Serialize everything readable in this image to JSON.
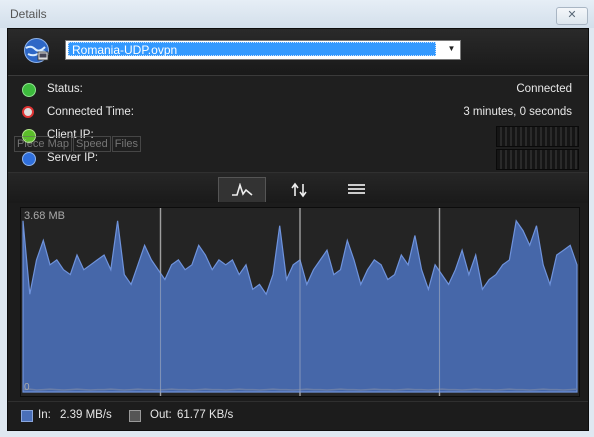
{
  "window": {
    "title": "Details",
    "close_label": "✕"
  },
  "profile": {
    "selected": "Romania-UDP.ovpn"
  },
  "info": {
    "status_label": "Status:",
    "status_value": "Connected",
    "time_label": "Connected Time:",
    "time_value": "3 minutes, 0 seconds",
    "client_ip_label": "Client IP:",
    "server_ip_label": "Server IP:"
  },
  "ghost_tabs": [
    "Piece Map",
    "Speed",
    "Files"
  ],
  "tabs": [
    {
      "name": "graph",
      "icon": "line-graph-icon"
    },
    {
      "name": "transfer",
      "icon": "up-down-arrows-icon"
    },
    {
      "name": "log",
      "icon": "list-icon"
    }
  ],
  "chart_data": {
    "type": "area",
    "ymax_label": "3.68 MB",
    "ymin_label": "0",
    "ylim": [
      0,
      3.68
    ],
    "x": [
      0,
      1,
      2,
      3,
      4,
      5,
      6,
      7,
      8,
      9,
      10,
      11,
      12,
      13,
      14,
      15,
      16,
      17,
      18,
      19,
      20,
      21,
      22,
      23,
      24,
      25,
      26,
      27,
      28,
      29,
      30,
      31,
      32,
      33,
      34,
      35,
      36,
      37,
      38,
      39,
      40,
      41,
      42,
      43,
      44,
      45,
      46,
      47,
      48,
      49,
      50,
      51,
      52,
      53,
      54,
      55,
      56,
      57,
      58,
      59,
      60,
      61,
      62,
      63,
      64,
      65,
      66,
      67,
      68,
      69,
      70,
      71,
      72,
      73,
      74,
      75,
      76,
      77,
      78,
      79,
      80,
      81,
      82
    ],
    "series": [
      {
        "in_values": [
          3.5,
          2.0,
          2.7,
          3.1,
          2.6,
          2.7,
          2.5,
          2.4,
          2.8,
          2.5,
          2.6,
          2.7,
          2.8,
          2.5,
          3.5,
          2.4,
          2.2,
          2.6,
          3.0,
          2.7,
          2.5,
          2.3,
          2.6,
          2.7,
          2.5,
          2.6,
          3.0,
          2.8,
          2.5,
          2.7,
          2.6,
          2.7,
          2.4,
          2.6,
          2.1,
          2.2,
          2.0,
          2.4,
          3.4,
          2.3,
          2.6,
          2.7,
          2.2,
          2.5,
          2.7,
          2.9,
          2.4,
          2.5,
          3.1,
          2.7,
          2.2,
          2.5,
          2.7,
          2.6,
          2.3,
          2.4,
          2.8,
          2.6,
          3.2,
          2.5,
          2.1,
          2.6,
          2.4,
          2.2,
          2.5,
          2.9,
          2.4,
          2.8,
          2.1,
          2.3,
          2.4,
          2.6,
          2.7,
          3.5,
          3.3,
          3.0,
          3.4,
          2.6,
          2.2,
          2.8,
          2.9,
          3.0,
          2.6
        ],
        "out_values": [
          0.05,
          0.06,
          0.04,
          0.05,
          0.06,
          0.05,
          0.04,
          0.05,
          0.06,
          0.05,
          0.04,
          0.05,
          0.05,
          0.06,
          0.05,
          0.04,
          0.05,
          0.06,
          0.05,
          0.05,
          0.04,
          0.05,
          0.06,
          0.05,
          0.05,
          0.04,
          0.05,
          0.06,
          0.05,
          0.05,
          0.04,
          0.05,
          0.06,
          0.05,
          0.05,
          0.04,
          0.05,
          0.06,
          0.05,
          0.05,
          0.04,
          0.05,
          0.06,
          0.05,
          0.05,
          0.04,
          0.05,
          0.06,
          0.05,
          0.05,
          0.04,
          0.05,
          0.06,
          0.05,
          0.05,
          0.04,
          0.05,
          0.06,
          0.05,
          0.05,
          0.04,
          0.05,
          0.06,
          0.05,
          0.05,
          0.04,
          0.05,
          0.06,
          0.05,
          0.05,
          0.04,
          0.05,
          0.06,
          0.05,
          0.05,
          0.04,
          0.05,
          0.06,
          0.05,
          0.05,
          0.04,
          0.05,
          0.06
        ]
      }
    ],
    "colors": {
      "in": "#4a6fb8",
      "out": "#6a7ea8"
    }
  },
  "legend": {
    "in_label": "In:",
    "in_value": "2.39 MB/s",
    "out_label": "Out:",
    "out_value": "61.77 KB/s"
  }
}
